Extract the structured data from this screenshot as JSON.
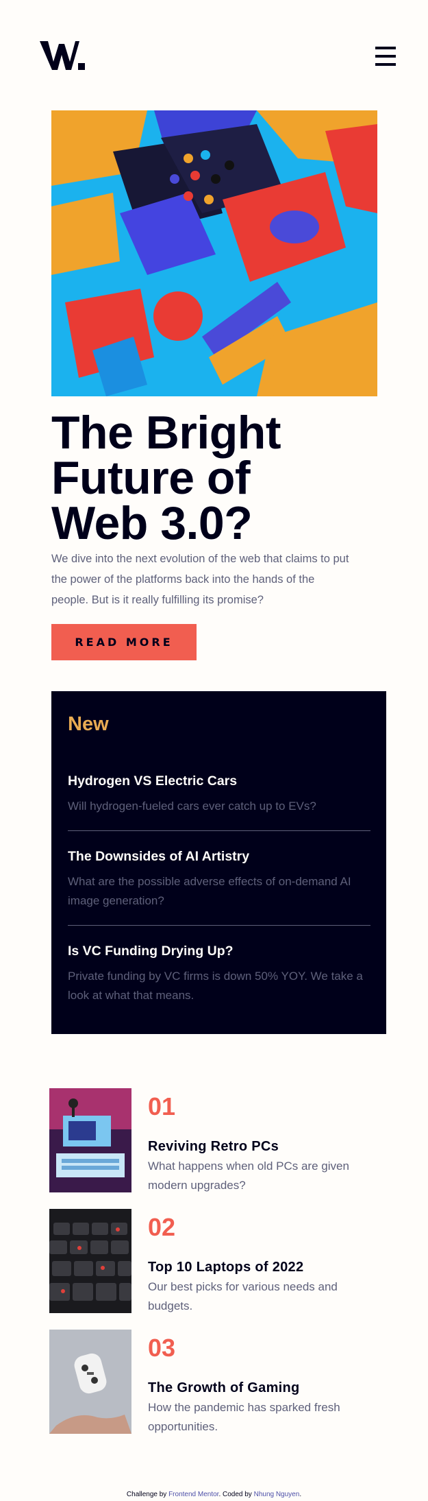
{
  "header": {
    "logo_text": "W.",
    "menu_icon": "hamburger-icon"
  },
  "hero": {
    "title": "The Bright Future of Web 3.0?",
    "description": "We dive into the next evolution of the web that claims to put the power of the platforms back into the hands of the people. But is it really fulfilling its promise?",
    "cta_label": "READ MORE"
  },
  "new_section": {
    "heading": "New",
    "items": [
      {
        "title": "Hydrogen VS Electric Cars",
        "description": "Will hydrogen-fueled cars ever catch up to EVs?"
      },
      {
        "title": "The Downsides of AI Artistry",
        "description": "What are the possible adverse effects of on-demand AI image generation?"
      },
      {
        "title": "Is VC Funding Drying Up?",
        "description": "Private funding by VC firms is down 50% YOY. We take a look at what that means."
      }
    ]
  },
  "articles": [
    {
      "number": "01",
      "title": "Reviving Retro PCs",
      "description": "What happens when old PCs are given modern upgrades?"
    },
    {
      "number": "02",
      "title": "Top 10 Laptops of 2022",
      "description": "Our best picks for various needs and budgets."
    },
    {
      "number": "03",
      "title": "The Growth of Gaming",
      "description": "How the pandemic has sparked fresh opportunities."
    }
  ],
  "footer": {
    "prefix": "Challenge by ",
    "link1": "Frontend Mentor",
    "middle": ". Coded by ",
    "link2": "Nhung Nguyen",
    "suffix": "."
  },
  "colors": {
    "soft_orange": "#e9ab53",
    "soft_red": "#f15e50",
    "very_dark_blue": "#00001a",
    "grayish_blue": "#5e607a",
    "off_white": "#fffdfa"
  }
}
